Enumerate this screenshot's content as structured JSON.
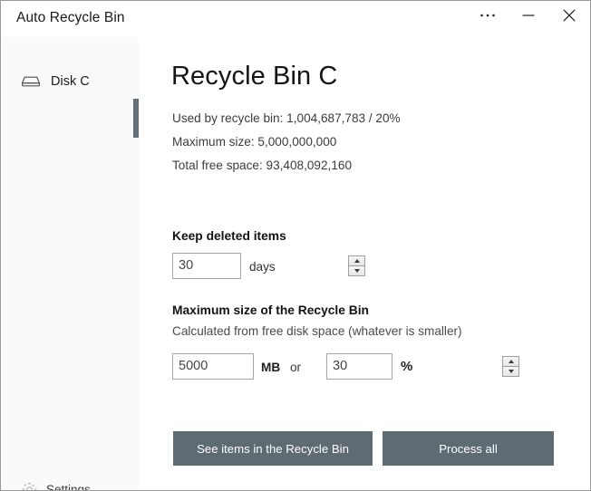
{
  "window": {
    "title": "Auto Recycle Bin",
    "controls": [
      {
        "name": "more-button",
        "glyph": "•••"
      },
      {
        "name": "minimize-button",
        "glyph": "—"
      },
      {
        "name": "close-button",
        "glyph": "✕"
      }
    ]
  },
  "sidebar": {
    "items": [
      {
        "label": "Disk C",
        "icon": "disk-icon",
        "selected": true
      }
    ],
    "settings": {
      "label": "Settings",
      "icon": "gear-icon"
    }
  },
  "main": {
    "title": "Recycle Bin C",
    "stats": [
      "Used by recycle bin: 1,004,687,783 / 20%",
      "Maximum size: 5,000,000,000",
      "Total free space: 93,408,092,160"
    ],
    "keep_section": {
      "heading": "Keep deleted items",
      "days_value": "30",
      "days_unit": "days"
    },
    "max_section": {
      "heading": "Maximum size of the Recycle Bin",
      "subtitle": "Calculated from free disk space (whatever is smaller)",
      "mb_value": "5000",
      "mb_unit": "MB",
      "conjunction": "or",
      "pct_value": "30",
      "pct_unit": "%"
    },
    "buttons": {
      "see_items": "See items in the Recycle Bin",
      "process_all": "Process all"
    }
  },
  "colors": {
    "accent": "#5f6b72",
    "selection_bar": "#667078",
    "sidebar_bg": "#fafafa",
    "window_border": "#9a9a9a"
  }
}
